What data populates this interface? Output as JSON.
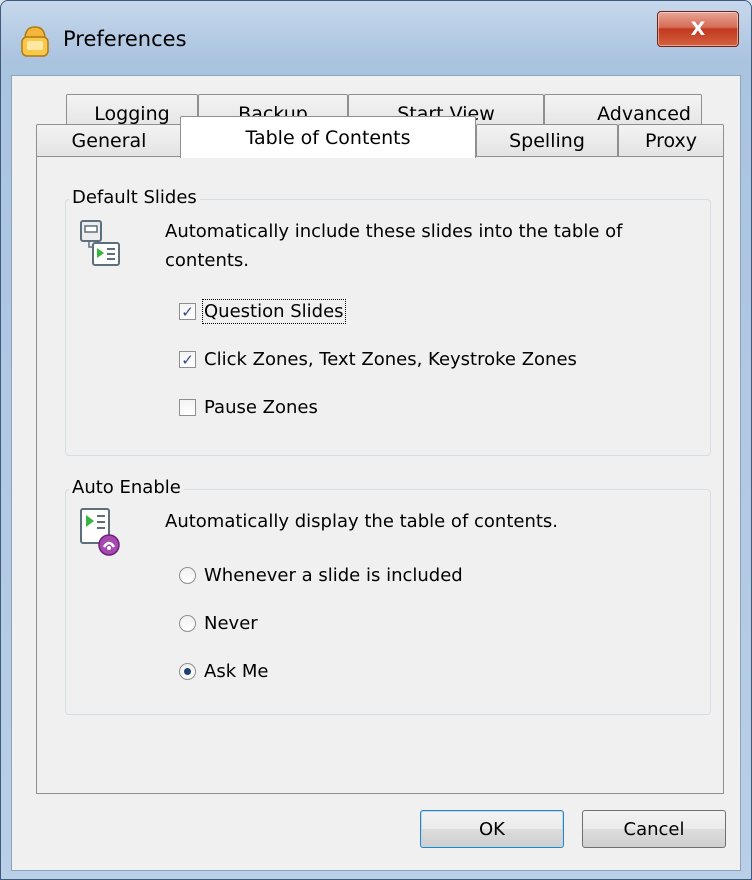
{
  "window": {
    "title": "Preferences",
    "close_label": "X"
  },
  "tabs": {
    "back_row": [
      "Logging",
      "Backup",
      "Start View",
      "Advanced"
    ],
    "front_row": [
      "General",
      "Table of Contents",
      "Spelling",
      "Proxy"
    ],
    "active": "Table of Contents"
  },
  "default_slides": {
    "title": "Default Slides",
    "description_line1": "Automatically include these slides into the table of",
    "description_line2": "contents.",
    "options": [
      {
        "label": "Question Slides",
        "checked": true
      },
      {
        "label": "Click Zones, Text Zones, Keystroke Zones",
        "checked": true
      },
      {
        "label": "Pause Zones",
        "checked": false
      }
    ]
  },
  "auto_enable": {
    "title": "Auto Enable",
    "description": "Automatically display the table of contents.",
    "options": [
      {
        "label": "Whenever a slide is included",
        "selected": false
      },
      {
        "label": "Never",
        "selected": false
      },
      {
        "label": "Ask Me",
        "selected": true
      }
    ]
  },
  "buttons": {
    "ok": "OK",
    "cancel": "Cancel"
  },
  "check_glyph": "✓"
}
